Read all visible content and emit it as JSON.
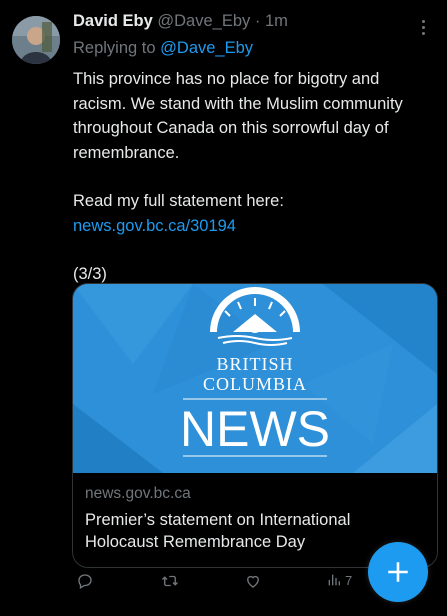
{
  "tweet": {
    "author_name": "David Eby",
    "handle": "@Dave_Eby",
    "separator": "·",
    "time": "1m",
    "reply_prefix": "Replying to",
    "reply_handle": "@Dave_Eby",
    "body_line1": "This province has no place for bigotry and racism. We stand with the Muslim community throughout Canada on this sorrowful day of remembrance.",
    "statement_prefix": "Read my full statement here:",
    "statement_link": "news.gov.bc.ca/30194",
    "thread_counter": "(3/3)"
  },
  "card": {
    "logo_line1": "BRITISH",
    "logo_line2": "COLUMBIA",
    "logo_news": "NEWS",
    "domain": "news.gov.bc.ca",
    "title": "Premier’s statement on International Holocaust Remembrance Day"
  },
  "actions": {
    "views_count": "7"
  },
  "colors": {
    "accent": "#1d9bf0",
    "background": "#000000",
    "muted": "#71767b",
    "text": "#e7e9ea",
    "card_blue": "#2d8fd6"
  },
  "icons": [
    "more-icon",
    "reply-icon",
    "retweet-icon",
    "like-icon",
    "views-icon",
    "compose-plus-icon"
  ]
}
